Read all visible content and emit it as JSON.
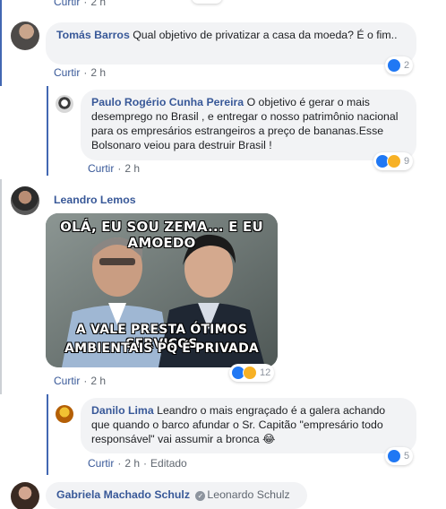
{
  "top_meta": {
    "reply": "Curtir",
    "time": "2 h"
  },
  "comments": [
    {
      "author": "Tomás Barros",
      "text": "Qual objetivo de privatizar a casa da moeda? É o fim..",
      "like": "Curtir",
      "time": "2 h",
      "reaction_count": "2"
    },
    {
      "author": "Paulo Rogério Cunha Pereira",
      "text": "O objetivo é gerar o mais desemprego no Brasil , e entregar o nosso patrimônio nacional para os empresários estrangeiros a preço de bananas.Esse Bolsonaro veiou para destruir Brasil !",
      "like": "Curtir",
      "time": "2 h",
      "reaction_count": "9"
    },
    {
      "author": "Leandro Lemos",
      "meme_top": "OLÁ, EU SOU ZEMA... E EU AMOEDO",
      "meme_bottom_1": "A VALE PRESTA ÓTIMOS SERVIÇOS",
      "meme_bottom_2": "AMBIENTAIS PQ É PRIVADA",
      "like": "Curtir",
      "time": "2 h",
      "reaction_count": "12"
    },
    {
      "author": "Danilo Lima",
      "text": "Leandro o mais engraçado é a galera achando que quando o barco afundar o Sr. Capitão \"empresário todo responsável\" vai assumir a bronca 😂",
      "like": "Curtir",
      "time": "2 h",
      "edited": "Editado",
      "reaction_count": "5"
    },
    {
      "author": "Gabriela Machado Schulz",
      "mention": "Leonardo Schulz"
    }
  ],
  "colors": {
    "like_blue": "#2078f4",
    "haha_yellow": "#f7b125",
    "thread_blue": "#4267b2"
  }
}
